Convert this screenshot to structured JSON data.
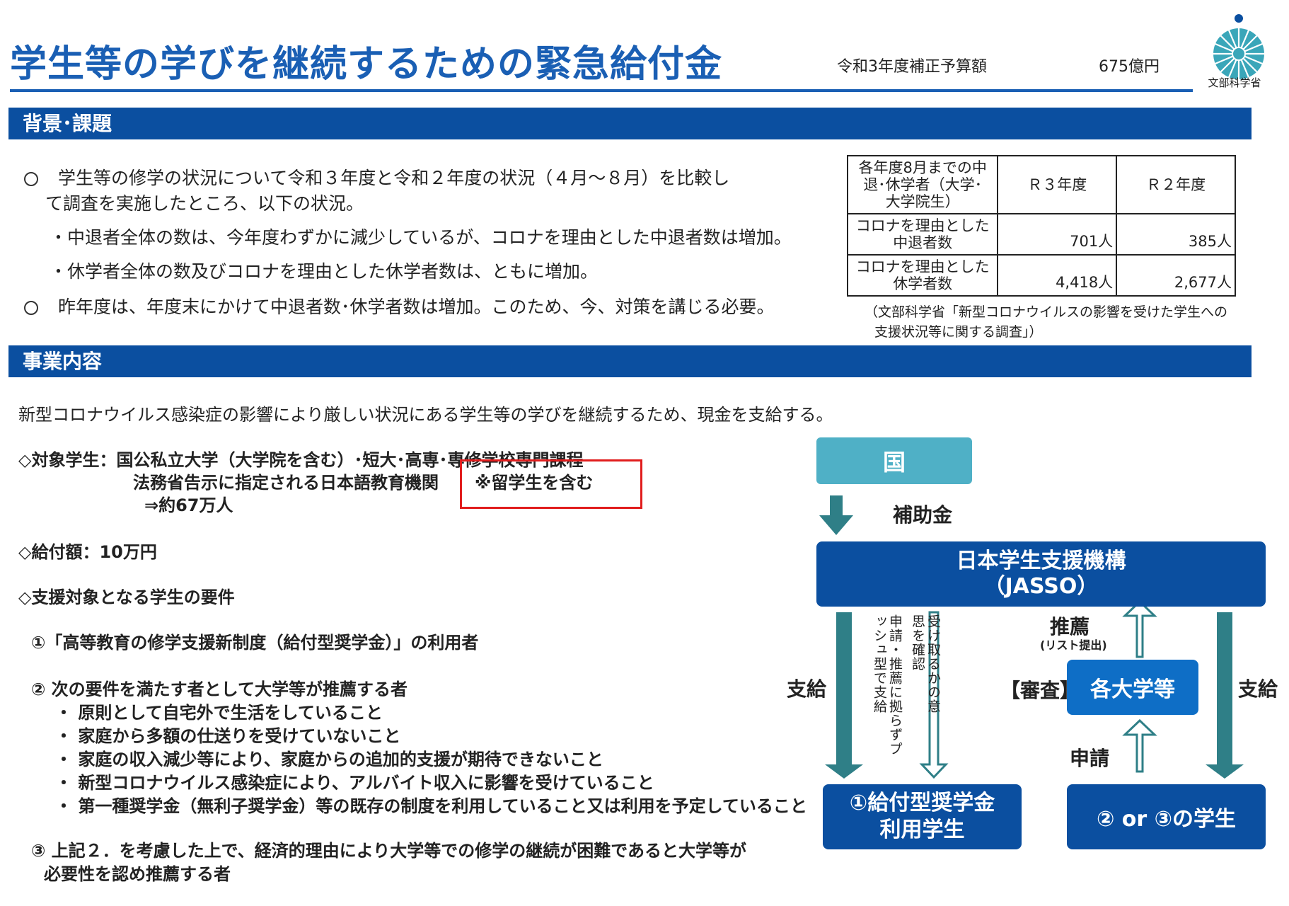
{
  "header": {
    "title": "学生等の学びを継続するための緊急給付金",
    "budget_label": "令和3年度補正予算額",
    "budget_amount": "675億円",
    "logo_text": "文部科学省"
  },
  "background": {
    "heading": "背景･課題",
    "paragraphs": [
      "学生等の修学の状況について令和３年度と令和２年度の状況（４月～８月）を比較し",
      "て調査を実施したところ、以下の状況。",
      "・中退者全体の数は、今年度わずかに減少しているが、コロナを理由とした中退者数は増加。",
      "・休学者全体の数及びコロナを理由とした休学者数は、ともに増加。",
      "昨年度は、年度末にかけて中退者数･休学者数は増加。このため、今、対策を講じる必要。"
    ],
    "table": {
      "corner_lines": [
        "各年度8月までの中",
        "退･休学者（大学･",
        "大学院生）"
      ],
      "col_r3": "Ｒ３年度",
      "col_r2": "Ｒ２年度",
      "rows": [
        {
          "label_lines": [
            "コロナを理由とした",
            "中退者数"
          ],
          "r3": "701人",
          "r2": "385人"
        },
        {
          "label_lines": [
            "コロナを理由とした",
            "休学者数"
          ],
          "r3": "4,418人",
          "r2": "2,677人"
        }
      ]
    },
    "source_lines": [
      "（文部科学省「新型コロナウイルスの影響を受けた学生への",
      "支援状況等に関する調査」）"
    ]
  },
  "business": {
    "heading": "事業内容",
    "intro": "新型コロナウイルス感染症の影響により厳しい状況にある学生等の学びを継続するため、現金を支給する。",
    "target_line1": "◇対象学生：国公私立大学（大学院を含む）･短大･高専･専修学校専門課程",
    "target_line2": "法務省告示に指定される日本語教育機関",
    "target_note": "※留学生を含む",
    "target_line3": "⇒約67万人",
    "amount": "◇給付額：10万円",
    "requirements_heading": "◇支援対象となる学生の要件",
    "req1": "①「高等教育の修学支援新制度（給付型奨学金）」の利用者",
    "req2": "② 次の要件を満たす者として大学等が推薦する者",
    "req2_items": [
      "・ 原則として自宅外で生活をしていること",
      "・ 家庭から多額の仕送りを受けていないこと",
      "・ 家庭の収入減少等により、家庭からの追加的支援が期待できないこと",
      "・ 新型コロナウイルス感染症により、アルバイト収入に影響を受けていること",
      "・ 第一種奨学金（無利子奨学金）等の既存の制度を利用していること又は利用を予定していること"
    ],
    "req3_line1": "③ 上記２．を考慮した上で、経済的理由により大学等での修学の継続が困難であると大学等が",
    "req3_line2": "必要性を認め推薦する者"
  },
  "flow": {
    "kuni": "国",
    "subsidy": "補助金",
    "jasso_line1": "日本学生支援機構",
    "jasso_line2": "（JASSO）",
    "suisen": "推薦",
    "list_submit": "(リスト提出)",
    "shinsa": "【審査】",
    "univ": "各大学等",
    "shinsei": "申請",
    "shikyu_left": "支給",
    "shikyu_right": "支給",
    "vertical_push": "申請・推薦に拠らずプッシュ型で支給",
    "vertical_confirm": "受け取るかの意思を確認",
    "kyufu_line1": "①給付型奨学金",
    "kyufu_line2": "利用学生",
    "gakusei": "② or ③の学生",
    "colors": {
      "teal": "#4fb0c6",
      "arrow": "#2f7f87",
      "navy": "#0b4fa0",
      "blue": "#0e6ec6",
      "highlight": "#e11d1d"
    }
  }
}
